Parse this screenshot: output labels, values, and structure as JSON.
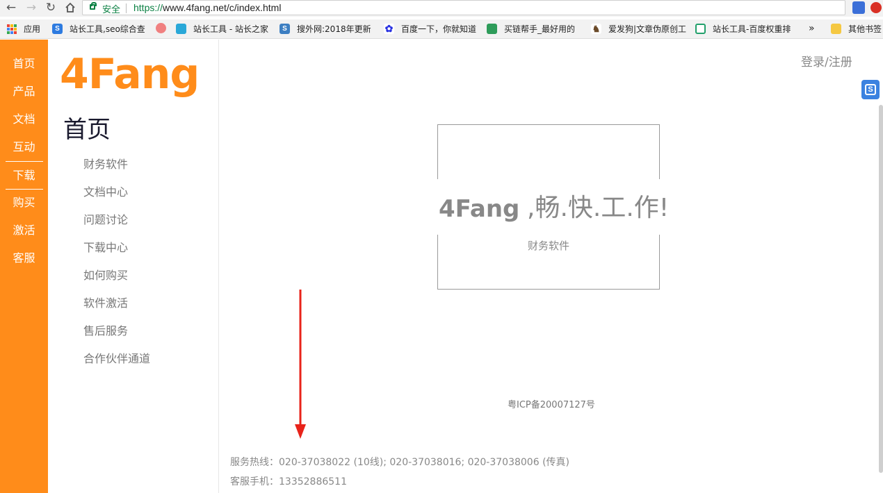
{
  "browser": {
    "secure_label": "安全",
    "url_scheme": "https://",
    "url_rest": "www.4fang.net/c/index.html",
    "bookmarks": [
      {
        "label": "应用",
        "icon": "apps-grid-icon"
      },
      {
        "label": "站长工具,seo综合查",
        "icon": "chinaz-icon"
      },
      {
        "label": "",
        "icon": "avatar-icon"
      },
      {
        "label": "站长工具 - 站长之家",
        "icon": "chinaz-bookmark-icon"
      },
      {
        "label": "搜外网:2018年更新",
        "icon": "souwai-icon"
      },
      {
        "label": "百度一下，你就知道",
        "icon": "baidu-paw-icon"
      },
      {
        "label": "买链帮手_最好用的",
        "icon": "maillian-icon"
      },
      {
        "label": "爱发狗|文章伪原创工",
        "icon": "dog-icon"
      },
      {
        "label": "站长工具-百度权重排",
        "icon": "aizhan-icon"
      }
    ],
    "more_label": "»",
    "other_bookmarks_label": "其他书签"
  },
  "nav": {
    "items": [
      "首页",
      "产品",
      "文档",
      "互动",
      "下载",
      "购买",
      "激活",
      "客服"
    ]
  },
  "logo": "4Fang",
  "section_title": "首页",
  "subnav": [
    "财务软件",
    "文档中心",
    "问题讨论",
    "下载中心",
    "如何购买",
    "软件激活",
    "售后服务",
    "合作伙伴通道"
  ],
  "login_label": "登录/注册",
  "hero": {
    "brand": "4Fang",
    "slogan": " ,畅.快.工.作!",
    "box_label": "财务软件"
  },
  "footer": {
    "icp": "粤ICP备20007127号",
    "hotline": "服务热线：020-37038022 (10线); 020-37038016; 020-37038006 (传真)",
    "mobile": "客服手机：13352886511"
  },
  "colors": {
    "brand_orange": "#ff8c1a",
    "annotation_arrow": "#e8231a"
  }
}
